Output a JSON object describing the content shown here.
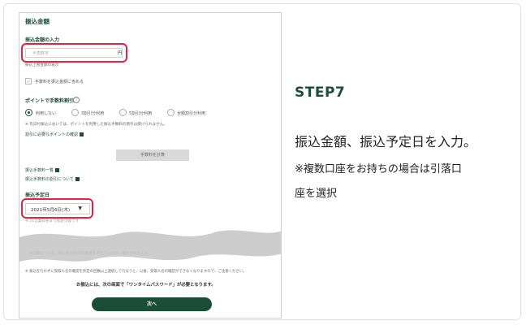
{
  "phone": {
    "section_title": "振込金額",
    "amount_label": "振込金額の入力",
    "amount_placeholder": "半角数字",
    "amount_unit": "円",
    "limit_link": "振込上限金額の表示",
    "fee_checkbox_label": "手数料を振込金額に含める",
    "points_label": "ポイントで手数料割引",
    "discount_options": [
      {
        "label": "利用しない",
        "selected": true
      },
      {
        "label": "3割引分利用",
        "selected": false
      },
      {
        "label": "5割引分利用",
        "selected": false
      },
      {
        "label": "全額割引分利用",
        "selected": false
      }
    ],
    "points_note": "※ 先日付振込においては、ポイントを利用した振込手数料の割引は受けられません。",
    "points_needed_link": "割引に必要なポイントの確認",
    "calc_button": "手数料を計算",
    "fee_list_link": "振込手数料一覧",
    "fee_discount_link": "振込手数料の割引について",
    "date_label": "振込予定日",
    "date_value": "2021年5月6日(木)",
    "date_note": "※ 31営業日先まで指定可能です",
    "faded_note_1": "…日以降について、振込先が確認の連絡をさせていただく場合があります。…",
    "warning_note": "※ 振込を行わずに受取人名の確認を所定の回数以上連続して行なうと、以後、受取人名の確認ができなくなりますので、ご注意ください。",
    "otp_notice": "お振込には、次の画面で「ワンタイムパスワード」が必要となります。",
    "next_button": "次へ"
  },
  "instructions": {
    "step": "STEP7",
    "line1": "振込金額、振込予定日を入力。",
    "line2": "※複数口座をお持ちの場合は引落口",
    "line3": "座を選択"
  },
  "colors": {
    "brand_green": "#1b4d37",
    "highlight_red": "#e4243f"
  }
}
